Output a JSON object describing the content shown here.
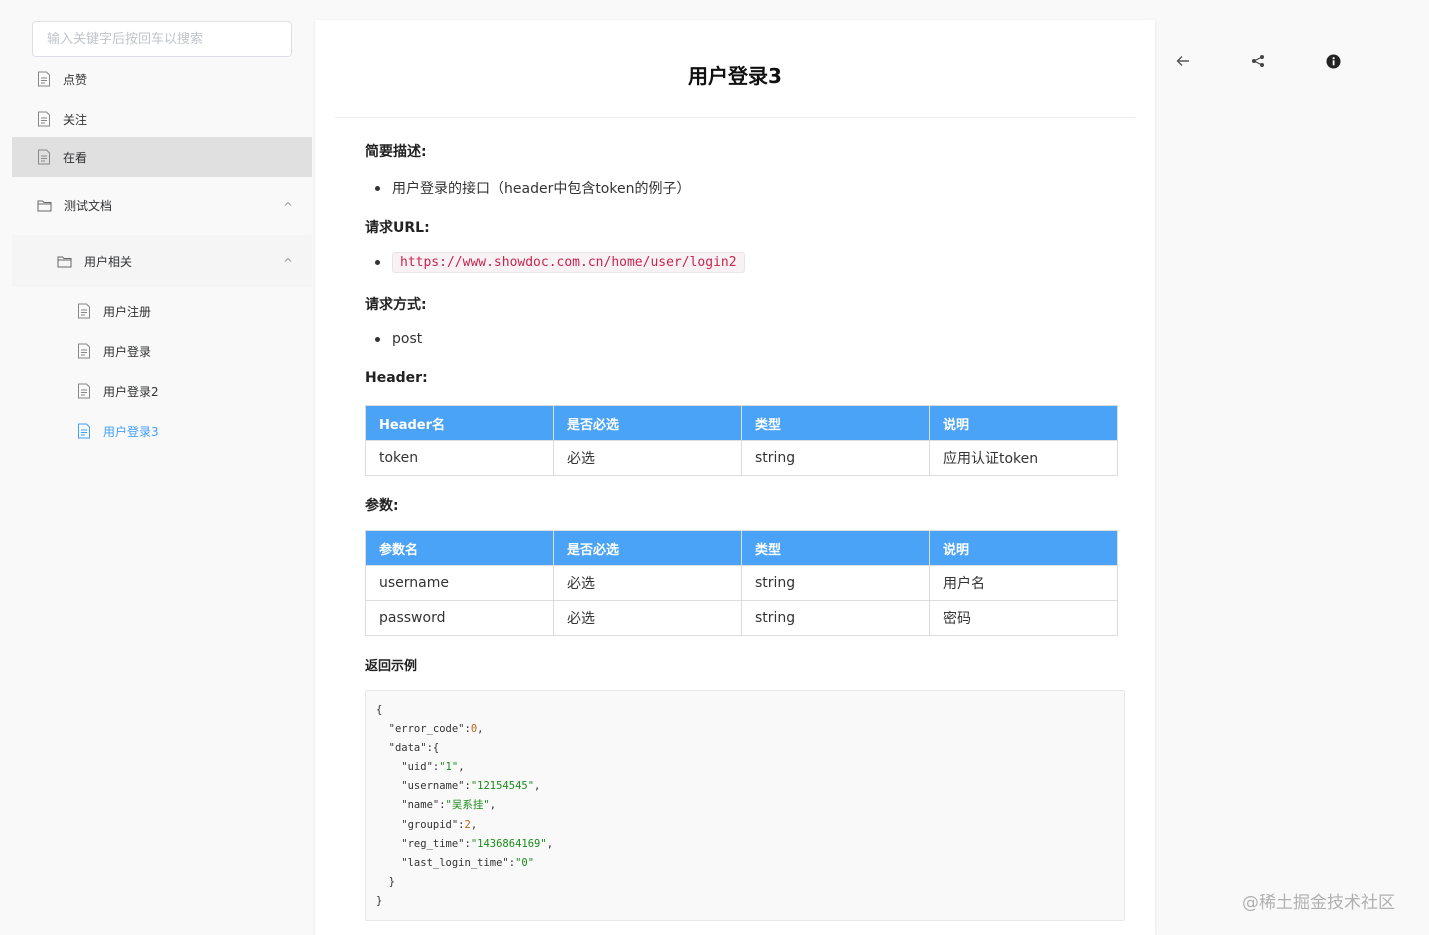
{
  "sidebar": {
    "search_placeholder": "输入关键字后按回车以搜索",
    "items": [
      {
        "label": "点赞"
      },
      {
        "label": "关注"
      },
      {
        "label": "在看"
      }
    ],
    "folder": {
      "label": "测试文档",
      "subfolder": {
        "label": "用户相关",
        "items": [
          {
            "label": "用户注册"
          },
          {
            "label": "用户登录"
          },
          {
            "label": "用户登录2"
          },
          {
            "label": "用户登录3"
          }
        ]
      }
    }
  },
  "doc": {
    "title": "用户登录3",
    "desc_heading": "简要描述:",
    "desc_item": "用户登录的接口（header中包含token的例子）",
    "url_heading": "请求URL:",
    "url": "https://www.showdoc.com.cn/home/user/login2",
    "method_heading": "请求方式:",
    "method": "post",
    "header_heading": "Header:",
    "header_table": {
      "columns": [
        "Header名",
        "是否必选",
        "类型",
        "说明"
      ],
      "rows": [
        [
          "token",
          "必选",
          "string",
          "应用认证token"
        ]
      ]
    },
    "params_heading": "参数:",
    "params_table": {
      "columns": [
        "参数名",
        "是否必选",
        "类型",
        "说明"
      ],
      "rows": [
        [
          "username",
          "必选",
          "string",
          "用户名"
        ],
        [
          "password",
          "必选",
          "string",
          "密码"
        ]
      ]
    },
    "example_heading": "返回示例",
    "example_lines": [
      "{",
      "  \"error_code\":0,",
      "  \"data\":{",
      "    \"uid\":\"1\",",
      "    \"username\":\"12154545\",",
      "    \"name\":\"吴系挂\",",
      "    \"groupid\":2,",
      "    \"reg_time\":\"1436864169\",",
      "    \"last_login_time\":\"0\"",
      "  }",
      "}"
    ]
  },
  "toolbar": {
    "icons": [
      "back-arrow-icon",
      "share-icon",
      "info-icon"
    ]
  },
  "watermark": "@稀土掘金技术社区",
  "colors": {
    "accent": "#409eff",
    "table_header": "#4ba3f8",
    "active_item_bg": "#e0e0e0"
  }
}
